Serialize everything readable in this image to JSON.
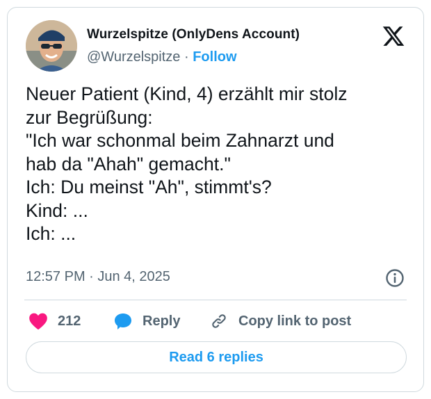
{
  "tweet": {
    "author_name": "Wurzelspitze (OnlyDens Account)",
    "author_handle": "@Wurzelspitze",
    "separator": "·",
    "follow_label": "Follow",
    "body_lines": [
      "Neuer Patient (Kind, 4) erzählt mir stolz",
      "zur Begrüßung:",
      "\"Ich war schonmal beim Zahnarzt und",
      "hab da \"Ahah\" gemacht.\"",
      "Ich: Du meinst \"Ah\", stimmt's?",
      "Kind: ...",
      "Ich: ..."
    ],
    "timestamp": "12:57 PM · Jun 4, 2025"
  },
  "actions": {
    "like_count": "212",
    "reply_label": "Reply",
    "copy_label": "Copy link to post"
  },
  "footer": {
    "read_replies_label": "Read 6 replies"
  },
  "colors": {
    "accent": "#1d9bf0",
    "like": "#f91880",
    "muted": "#536471",
    "border": "#cfd9de"
  },
  "icons": [
    "x-logo-icon",
    "info-icon",
    "heart-icon",
    "reply-bubble-icon",
    "link-icon"
  ]
}
